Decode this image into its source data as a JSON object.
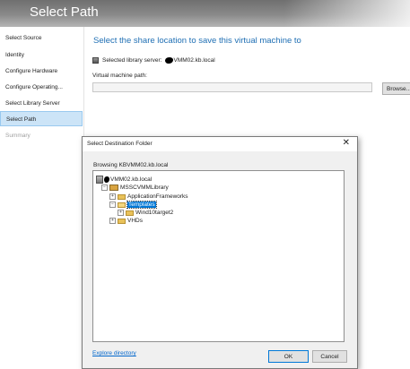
{
  "header": {
    "title": "Select Path"
  },
  "sidebar": {
    "items": [
      {
        "label": "Select Source"
      },
      {
        "label": "Identity"
      },
      {
        "label": "Configure Hardware"
      },
      {
        "label": "Configure Operating..."
      },
      {
        "label": "Select Library Server"
      },
      {
        "label": "Select Path"
      },
      {
        "label": "Summary"
      }
    ]
  },
  "main": {
    "heading": "Select the share location to save this virtual machine to",
    "library_server_label": "Selected library server:",
    "library_server_value": "VMM02.kb.local",
    "vm_path_label": "Virtual machine path:",
    "vm_path_value": "",
    "browse_label": "Browse..."
  },
  "dialog": {
    "title": "Select Destination Folder",
    "close_glyph": "✕",
    "browsing_text": "Browsing KBVMM02.kb.local",
    "tree": {
      "server": "VMM02.kb.local",
      "library": "MSSCVMMLibrary",
      "folder_application_frameworks": "ApplicationFrameworks",
      "folder_templates": "Templates",
      "folder_wind10target2": "Wind10target2",
      "folder_vhds": "VHDs",
      "expand_glyph": "+",
      "collapse_glyph": "−"
    },
    "explore_link": "Explore directory",
    "ok_label": "OK",
    "cancel_label": "Cancel"
  },
  "colors": {
    "accent": "#1f6fb4",
    "selection": "#0078d7",
    "sidebar_active": "#cce4f7"
  }
}
